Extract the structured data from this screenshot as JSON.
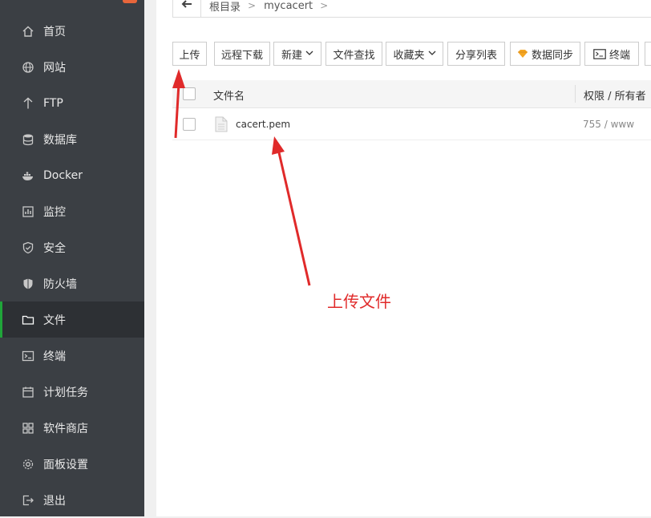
{
  "sidebar": {
    "items": [
      {
        "label": "首页",
        "icon": "home-icon"
      },
      {
        "label": "网站",
        "icon": "globe-icon"
      },
      {
        "label": "FTP",
        "icon": "ftp-icon"
      },
      {
        "label": "数据库",
        "icon": "database-icon"
      },
      {
        "label": "Docker",
        "icon": "docker-icon"
      },
      {
        "label": "监控",
        "icon": "monitor-icon"
      },
      {
        "label": "安全",
        "icon": "shield-icon"
      },
      {
        "label": "防火墙",
        "icon": "firewall-icon"
      },
      {
        "label": "文件",
        "icon": "folder-icon",
        "active": true
      },
      {
        "label": "终端",
        "icon": "terminal-icon"
      },
      {
        "label": "计划任务",
        "icon": "calendar-icon"
      },
      {
        "label": "软件商店",
        "icon": "grid-icon"
      },
      {
        "label": "面板设置",
        "icon": "gear-icon"
      },
      {
        "label": "退出",
        "icon": "logout-icon"
      }
    ]
  },
  "breadcrumb": {
    "items": [
      "根目录",
      "mycacert"
    ]
  },
  "toolbar": {
    "upload": "上传",
    "remote_download": "远程下载",
    "new": "新建",
    "file_search": "文件查找",
    "favorites": "收藏夹",
    "share_list": "分享列表",
    "data_sync": "数据同步",
    "terminal": "终端"
  },
  "table": {
    "headers": {
      "name": "文件名",
      "perm": "权限 / 所有者"
    },
    "rows": [
      {
        "name": "cacert.pem",
        "perm": "755 / www"
      }
    ]
  },
  "annotation": {
    "text": "上传文件"
  },
  "colors": {
    "sidebar_bg": "#3b3f44",
    "active_accent": "#20a53a",
    "annotation_red": "#e02a2a"
  }
}
